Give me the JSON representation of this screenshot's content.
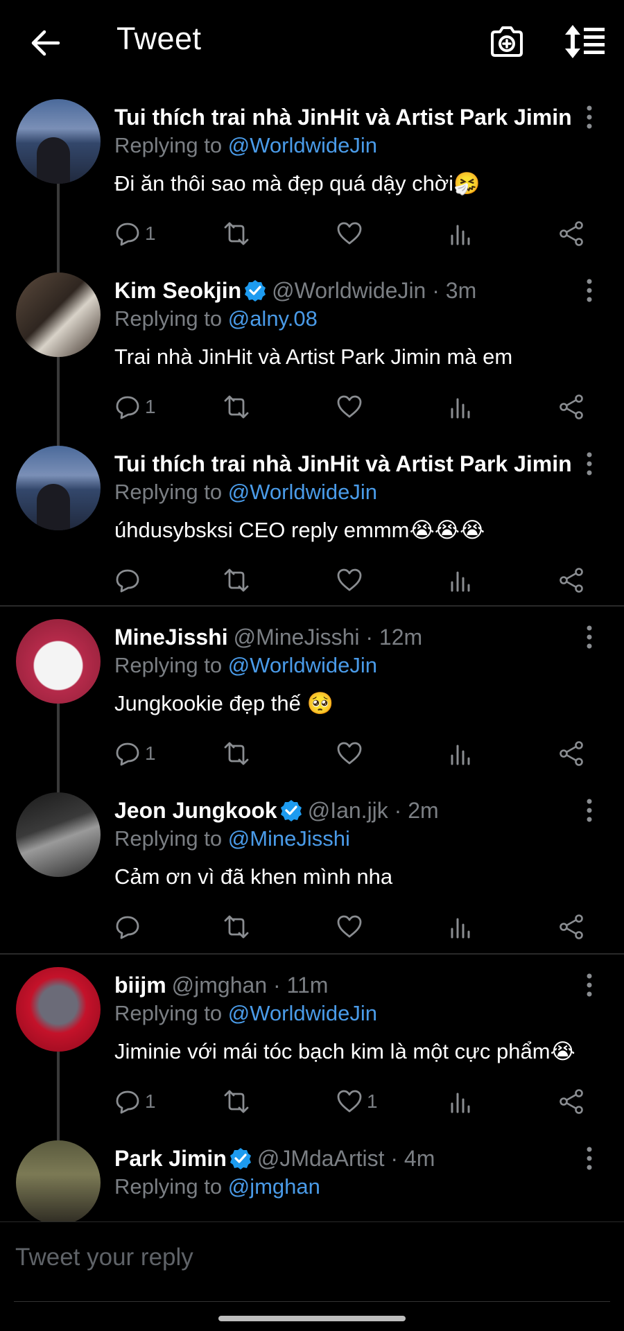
{
  "header": {
    "title": "Tweet",
    "back_icon": "arrow-left-icon",
    "camera_icon": "camera-plus-icon",
    "sort_icon": "sort-list-icon"
  },
  "colors": {
    "background": "#000000",
    "text": "#ffffff",
    "muted": "#7b7f84",
    "link": "#4a9be8",
    "verified": "#1d9bf0"
  },
  "tweets": [
    {
      "name": "Tui thích trai nhà JinHit và Artist Park Jimin",
      "name_ellipsis": " ...",
      "handle": "",
      "time": "",
      "verified": false,
      "replying_prefix": "Replying to",
      "replying_to": "@WorldwideJin",
      "text": "Đi ăn thôi sao mà đẹp quá dậy chời🤧",
      "reply_count": "1",
      "like_count": ""
    },
    {
      "name": "Kim Seokjin",
      "name_ellipsis": "",
      "handle": "@WorldwideJin · 3m",
      "verified": true,
      "replying_prefix": "Replying to",
      "replying_to": "@alny.08",
      "text": "Trai nhà JinHit và Artist Park Jimin mà em",
      "reply_count": "1",
      "like_count": ""
    },
    {
      "name": "Tui thích trai nhà JinHit và Artist Park Jimin",
      "name_ellipsis": " ...",
      "handle": "",
      "verified": false,
      "replying_prefix": "Replying to",
      "replying_to": "@WorldwideJin",
      "text": "úhdusybsksi CEO reply emmm😭😭😭",
      "reply_count": "",
      "like_count": ""
    },
    {
      "name": "MineJisshi",
      "name_ellipsis": "",
      "handle": "@MineJisshi · 12m",
      "verified": false,
      "replying_prefix": "Replying to",
      "replying_to": "@WorldwideJin",
      "text": "Jungkookie đẹp thế 🥺",
      "reply_count": "1",
      "like_count": ""
    },
    {
      "name": "Jeon Jungkook",
      "name_ellipsis": "",
      "handle": "@Ian.jjk · 2m",
      "verified": true,
      "replying_prefix": "Replying to",
      "replying_to": "@MineJisshi",
      "text": "Cảm ơn vì đã khen mình nha",
      "reply_count": "",
      "like_count": ""
    },
    {
      "name": "biijm",
      "name_ellipsis": "",
      "handle": "@jmghan · 11m",
      "verified": false,
      "replying_prefix": "Replying to",
      "replying_to": "@WorldwideJin",
      "text": "Jiminie với mái tóc bạch kim là một cực phẩm😭",
      "reply_count": "1",
      "like_count": "1"
    },
    {
      "name": "Park Jimin",
      "name_ellipsis": "",
      "handle": "@JMdaArtist · 4m",
      "verified": true,
      "replying_prefix": "Replying to",
      "replying_to": "@jmghan",
      "text": "",
      "reply_count": "",
      "like_count": ""
    }
  ],
  "reply_box": {
    "placeholder": "Tweet your reply"
  }
}
